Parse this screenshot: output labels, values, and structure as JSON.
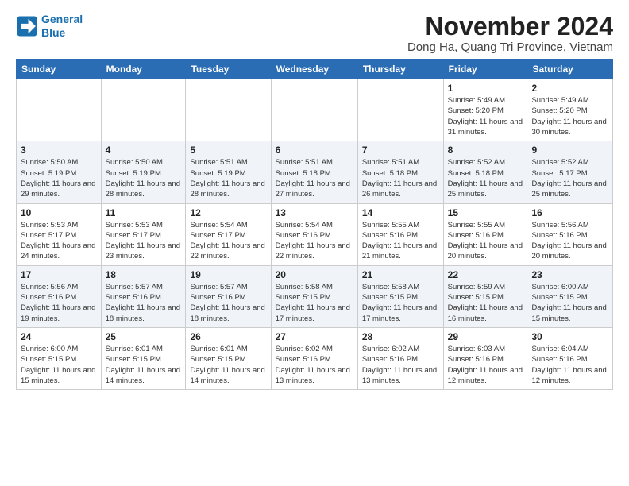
{
  "logo": {
    "line1": "General",
    "line2": "Blue"
  },
  "title": "November 2024",
  "subtitle": "Dong Ha, Quang Tri Province, Vietnam",
  "weekdays": [
    "Sunday",
    "Monday",
    "Tuesday",
    "Wednesday",
    "Thursday",
    "Friday",
    "Saturday"
  ],
  "weeks": [
    [
      {
        "day": "",
        "info": ""
      },
      {
        "day": "",
        "info": ""
      },
      {
        "day": "",
        "info": ""
      },
      {
        "day": "",
        "info": ""
      },
      {
        "day": "",
        "info": ""
      },
      {
        "day": "1",
        "info": "Sunrise: 5:49 AM\nSunset: 5:20 PM\nDaylight: 11 hours and 31 minutes."
      },
      {
        "day": "2",
        "info": "Sunrise: 5:49 AM\nSunset: 5:20 PM\nDaylight: 11 hours and 30 minutes."
      }
    ],
    [
      {
        "day": "3",
        "info": "Sunrise: 5:50 AM\nSunset: 5:19 PM\nDaylight: 11 hours and 29 minutes."
      },
      {
        "day": "4",
        "info": "Sunrise: 5:50 AM\nSunset: 5:19 PM\nDaylight: 11 hours and 28 minutes."
      },
      {
        "day": "5",
        "info": "Sunrise: 5:51 AM\nSunset: 5:19 PM\nDaylight: 11 hours and 28 minutes."
      },
      {
        "day": "6",
        "info": "Sunrise: 5:51 AM\nSunset: 5:18 PM\nDaylight: 11 hours and 27 minutes."
      },
      {
        "day": "7",
        "info": "Sunrise: 5:51 AM\nSunset: 5:18 PM\nDaylight: 11 hours and 26 minutes."
      },
      {
        "day": "8",
        "info": "Sunrise: 5:52 AM\nSunset: 5:18 PM\nDaylight: 11 hours and 25 minutes."
      },
      {
        "day": "9",
        "info": "Sunrise: 5:52 AM\nSunset: 5:17 PM\nDaylight: 11 hours and 25 minutes."
      }
    ],
    [
      {
        "day": "10",
        "info": "Sunrise: 5:53 AM\nSunset: 5:17 PM\nDaylight: 11 hours and 24 minutes."
      },
      {
        "day": "11",
        "info": "Sunrise: 5:53 AM\nSunset: 5:17 PM\nDaylight: 11 hours and 23 minutes."
      },
      {
        "day": "12",
        "info": "Sunrise: 5:54 AM\nSunset: 5:17 PM\nDaylight: 11 hours and 22 minutes."
      },
      {
        "day": "13",
        "info": "Sunrise: 5:54 AM\nSunset: 5:16 PM\nDaylight: 11 hours and 22 minutes."
      },
      {
        "day": "14",
        "info": "Sunrise: 5:55 AM\nSunset: 5:16 PM\nDaylight: 11 hours and 21 minutes."
      },
      {
        "day": "15",
        "info": "Sunrise: 5:55 AM\nSunset: 5:16 PM\nDaylight: 11 hours and 20 minutes."
      },
      {
        "day": "16",
        "info": "Sunrise: 5:56 AM\nSunset: 5:16 PM\nDaylight: 11 hours and 20 minutes."
      }
    ],
    [
      {
        "day": "17",
        "info": "Sunrise: 5:56 AM\nSunset: 5:16 PM\nDaylight: 11 hours and 19 minutes."
      },
      {
        "day": "18",
        "info": "Sunrise: 5:57 AM\nSunset: 5:16 PM\nDaylight: 11 hours and 18 minutes."
      },
      {
        "day": "19",
        "info": "Sunrise: 5:57 AM\nSunset: 5:16 PM\nDaylight: 11 hours and 18 minutes."
      },
      {
        "day": "20",
        "info": "Sunrise: 5:58 AM\nSunset: 5:15 PM\nDaylight: 11 hours and 17 minutes."
      },
      {
        "day": "21",
        "info": "Sunrise: 5:58 AM\nSunset: 5:15 PM\nDaylight: 11 hours and 17 minutes."
      },
      {
        "day": "22",
        "info": "Sunrise: 5:59 AM\nSunset: 5:15 PM\nDaylight: 11 hours and 16 minutes."
      },
      {
        "day": "23",
        "info": "Sunrise: 6:00 AM\nSunset: 5:15 PM\nDaylight: 11 hours and 15 minutes."
      }
    ],
    [
      {
        "day": "24",
        "info": "Sunrise: 6:00 AM\nSunset: 5:15 PM\nDaylight: 11 hours and 15 minutes."
      },
      {
        "day": "25",
        "info": "Sunrise: 6:01 AM\nSunset: 5:15 PM\nDaylight: 11 hours and 14 minutes."
      },
      {
        "day": "26",
        "info": "Sunrise: 6:01 AM\nSunset: 5:15 PM\nDaylight: 11 hours and 14 minutes."
      },
      {
        "day": "27",
        "info": "Sunrise: 6:02 AM\nSunset: 5:16 PM\nDaylight: 11 hours and 13 minutes."
      },
      {
        "day": "28",
        "info": "Sunrise: 6:02 AM\nSunset: 5:16 PM\nDaylight: 11 hours and 13 minutes."
      },
      {
        "day": "29",
        "info": "Sunrise: 6:03 AM\nSunset: 5:16 PM\nDaylight: 11 hours and 12 minutes."
      },
      {
        "day": "30",
        "info": "Sunrise: 6:04 AM\nSunset: 5:16 PM\nDaylight: 11 hours and 12 minutes."
      }
    ]
  ]
}
